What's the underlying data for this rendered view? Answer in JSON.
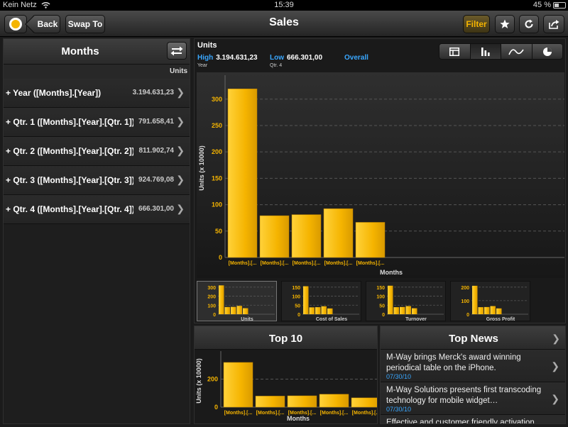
{
  "status_bar": {
    "carrier": "Kein Netz",
    "time": "15:39",
    "battery": "45 %",
    "battery_level": 0.45
  },
  "nav": {
    "back_label": "Back",
    "swap_label": "Swap To",
    "title": "Sales",
    "filter_label": "Filter"
  },
  "icons": {
    "logo": "app-logo-icon",
    "star": "star-icon",
    "refresh": "refresh-icon",
    "share": "share-icon",
    "swap": "swap-arrows-icon",
    "chevron": "chevron-right-icon"
  },
  "colors": {
    "accent": "#f5b400",
    "link": "#39a7ff"
  },
  "left_panel": {
    "title": "Months",
    "column_header": "Units",
    "rows": [
      {
        "label": "+ Year ([Months].[Year])",
        "value": "3.194.631,23"
      },
      {
        "label": "+ Qtr. 1 ([Months].[Year].[Qtr. 1])",
        "value": "791.658,41"
      },
      {
        "label": "+ Qtr. 2 ([Months].[Year].[Qtr. 2])",
        "value": "811.902,74"
      },
      {
        "label": "+ Qtr. 3 ([Months].[Year].[Qtr. 3])",
        "value": "924.769,08"
      },
      {
        "label": "+ Qtr. 4 ([Months].[Year].[Qtr. 4])",
        "value": "666.301,00"
      }
    ]
  },
  "main_panel": {
    "title": "Units",
    "high_label": "High",
    "high_value": "3.194.631,23",
    "high_sub": "Year",
    "low_label": "Low",
    "low_value": "666.301,00",
    "low_sub": "Qtr. 4",
    "overall_label": "Overall",
    "view_modes": [
      "table-icon",
      "bar-chart-icon",
      "line-chart-icon",
      "pie-chart-icon"
    ],
    "active_mode": 1
  },
  "chart_data": [
    {
      "type": "bar",
      "categories": [
        "[Months].[...",
        "[Months].[...",
        "[Months].[...",
        "[Months].[...",
        "[Months].[..."
      ],
      "values": [
        319.5,
        79.2,
        81.2,
        92.5,
        66.6
      ],
      "xlabel": "Months",
      "ylabel": "Units (x 10000)",
      "yticks": [
        0,
        50,
        100,
        150,
        200,
        250,
        300
      ],
      "ylim": [
        0,
        340
      ],
      "grid": true
    },
    {
      "type": "bar",
      "categories": [
        "[Months].[...",
        "[Months].[...",
        "[Months].[...",
        "[Months].[...",
        "[Months].[..."
      ],
      "values": [
        319.5,
        79.2,
        81.2,
        92.5,
        66.6
      ],
      "xlabel": "Months",
      "ylabel": "Units (x 10000)",
      "yticks": [
        0,
        200
      ],
      "ylim": [
        0,
        380
      ],
      "grid": true
    }
  ],
  "thumbnails": [
    {
      "label": "Units",
      "ticks": [
        0,
        100,
        200,
        300
      ],
      "max": 330,
      "values": [
        319.5,
        79.2,
        81.2,
        92.5,
        66.6
      ]
    },
    {
      "label": "Cost of Sales",
      "ticks": [
        0,
        50,
        100,
        150
      ],
      "max": 165,
      "values": [
        155,
        38,
        39,
        44,
        32
      ]
    },
    {
      "label": "Turnover",
      "ticks": [
        0,
        50,
        100,
        150
      ],
      "max": 165,
      "values": [
        158,
        39,
        40,
        45,
        33
      ]
    },
    {
      "label": "Gross Profit",
      "ticks": [
        0,
        100,
        200
      ],
      "max": 220,
      "values": [
        210,
        52,
        53,
        60,
        43
      ]
    }
  ],
  "top10": {
    "title": "Top 10"
  },
  "news": {
    "title": "Top News",
    "items": [
      {
        "title": "M-Way brings Merck's award winning periodical table on the iPhone.",
        "date": "07/30/10"
      },
      {
        "title": "M-Way Solutions presents first transcoding technology for mobile widget…",
        "date": "07/30/10"
      },
      {
        "title": "Effective and customer friendly activation",
        "date": ""
      }
    ]
  }
}
